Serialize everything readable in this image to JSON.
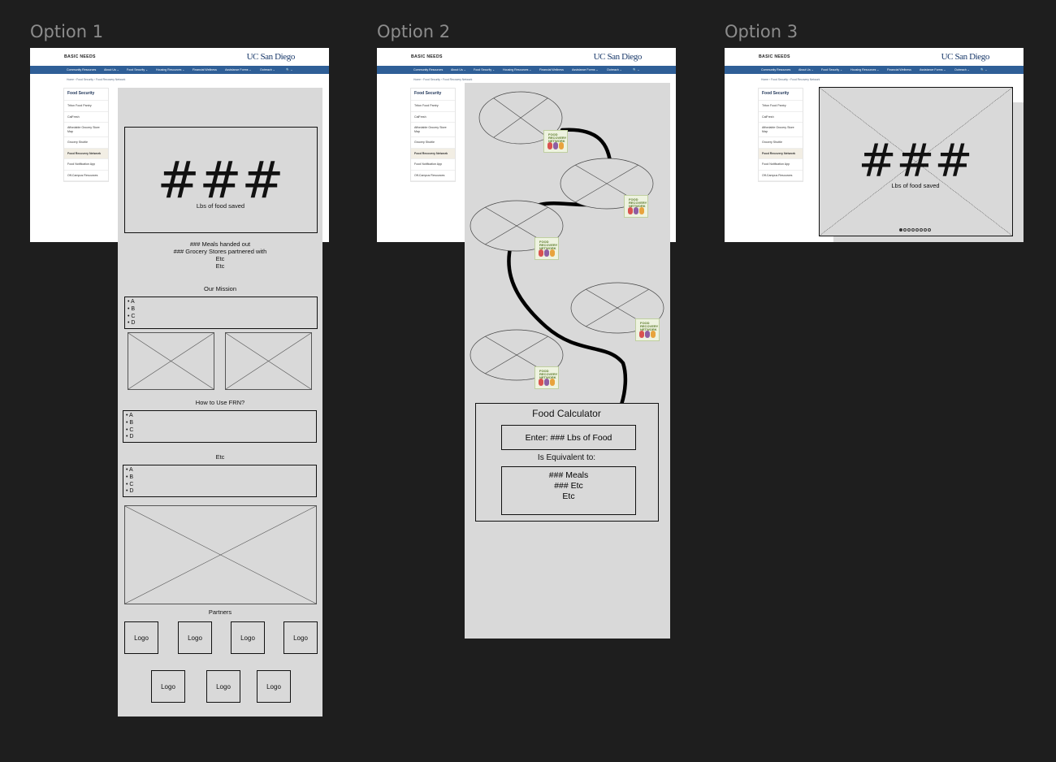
{
  "options": [
    "Option 1",
    "Option 2",
    "Option 3"
  ],
  "site": {
    "brand": "BASIC NEEDS",
    "logo_text": "UC San Diego",
    "nav": [
      "Community Resources",
      "About Us ⌄",
      "Food Security ⌄",
      "Housing Resources ⌄",
      "Financial Wellness",
      "Assistance Forms ⌄",
      "Outreach ⌄",
      "🔍 ⌄"
    ],
    "breadcrumb": "Home  ›  Food Security  ›  Food Recovery Network",
    "sidebar_title": "Food Security",
    "sidebar_items": [
      "Triton Food Pantry",
      "CalFresh",
      "Affordable Grocery Store Map",
      "Grocery Shuttle",
      "Food Recovery Network",
      "Food Notification App",
      "Off-Campus Resources"
    ],
    "sidebar_active": "Food Recovery Network"
  },
  "option1": {
    "big_number": "###",
    "big_caption": "Lbs of food saved",
    "stats": [
      "### Meals handed out",
      "### Grocery Stores partnered with",
      "Etc",
      "Etc"
    ],
    "mission_heading": "Our Mission",
    "mission_items": [
      "A",
      "B",
      "C",
      "D"
    ],
    "howto_heading": "How to Use FRN?",
    "howto_items": [
      "A",
      "B",
      "C",
      "D"
    ],
    "etc_heading": "Etc",
    "etc_items": [
      "A",
      "B",
      "C",
      "D"
    ],
    "partners_heading": "Partners",
    "logos_row1": [
      "Logo",
      "Logo",
      "Logo",
      "Logo"
    ],
    "logos_row2": [
      "Logo",
      "Logo",
      "Logo"
    ]
  },
  "option2": {
    "icon_text": "FOOD RECOVERY NETWORK",
    "calc_title": "Food Calculator",
    "calc_input": "Enter: ### Lbs of Food",
    "calc_equiv": "Is Equivalent to:",
    "calc_results": [
      "### Meals",
      "### Etc",
      "Etc"
    ]
  },
  "option3": {
    "big_number": "###",
    "big_caption": "Lbs of food saved",
    "carousel_dots": 8
  }
}
